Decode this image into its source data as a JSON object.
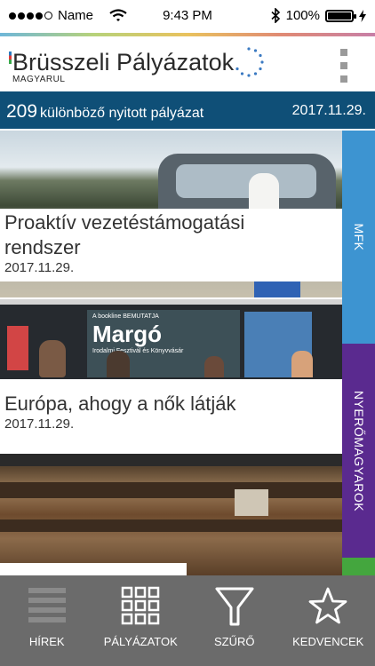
{
  "status_bar": {
    "carrier": "Name",
    "time": "9:43 PM",
    "battery": "100%",
    "battery_level": 1.0
  },
  "header": {
    "title": "Brüsszeli Pályázatok",
    "subtitle": "MAGYARUL"
  },
  "info_bar": {
    "count": "209",
    "count_text": "különböző nyitott pályázat",
    "date": "2017.11.29."
  },
  "cards": [
    {
      "title_line1": "Proaktív vezetéstámogatási",
      "title_line2": "rendszer",
      "date": "2017.11.29."
    },
    {
      "title": "Európa, ahogy a nők látják",
      "date": "2017.11.29.",
      "poster_brand": "A bookline BEMUTATJA",
      "poster_title": "Margó",
      "poster_subtitle": "Irodalmi Fesztivál és Könyvvásár"
    },
    {
      "title": ""
    }
  ],
  "side_tabs": [
    {
      "label": "MFK",
      "color": "#3d94d1"
    },
    {
      "label": "NYERŐMAGYAROK",
      "color": "#5a2a8f"
    },
    {
      "label": "",
      "color": "#44a63e"
    }
  ],
  "tabbar": [
    {
      "label": "HÍREK",
      "icon": "list-icon"
    },
    {
      "label": "PÁLYÁZATOK",
      "icon": "grid-icon"
    },
    {
      "label": "SZŰRŐ",
      "icon": "filter-icon"
    },
    {
      "label": "KEDVENCEK",
      "icon": "star-icon"
    }
  ]
}
